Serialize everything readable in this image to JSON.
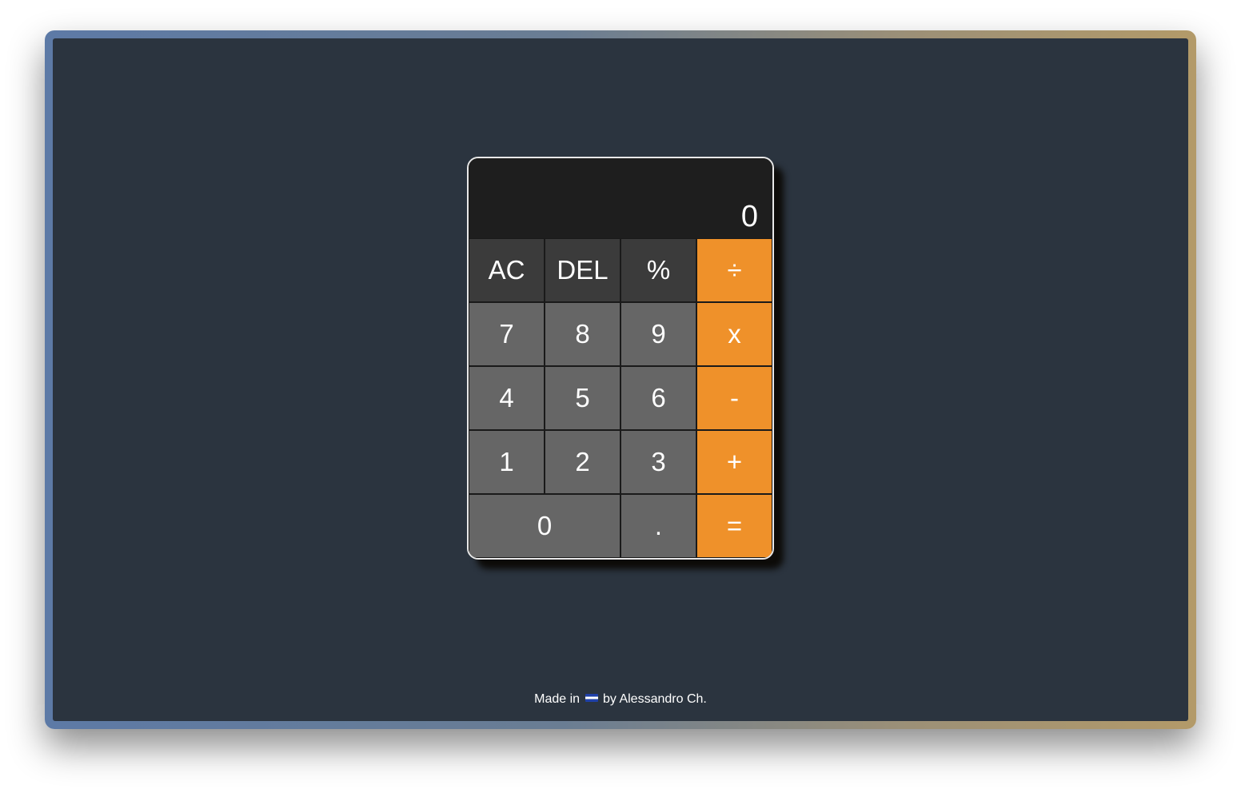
{
  "calculator": {
    "display": "0",
    "keys": {
      "ac": "AC",
      "del": "DEL",
      "percent": "%",
      "divide": "÷",
      "seven": "7",
      "eight": "8",
      "nine": "9",
      "multiply": "x",
      "four": "4",
      "five": "5",
      "six": "6",
      "minus": "-",
      "one": "1",
      "two": "2",
      "three": "3",
      "plus": "+",
      "zero": "0",
      "decimal": ".",
      "equals": "="
    }
  },
  "footer": {
    "prefix": "Made in",
    "flag_icon": "el-salvador-flag-icon",
    "suffix": "by Alessandro Ch."
  },
  "colors": {
    "background": "#2b343f",
    "display": "#1e1e1e",
    "function_key": "#3b3b3b",
    "number_key": "#666666",
    "operator_key": "#ef912a",
    "text": "#ffffff"
  }
}
